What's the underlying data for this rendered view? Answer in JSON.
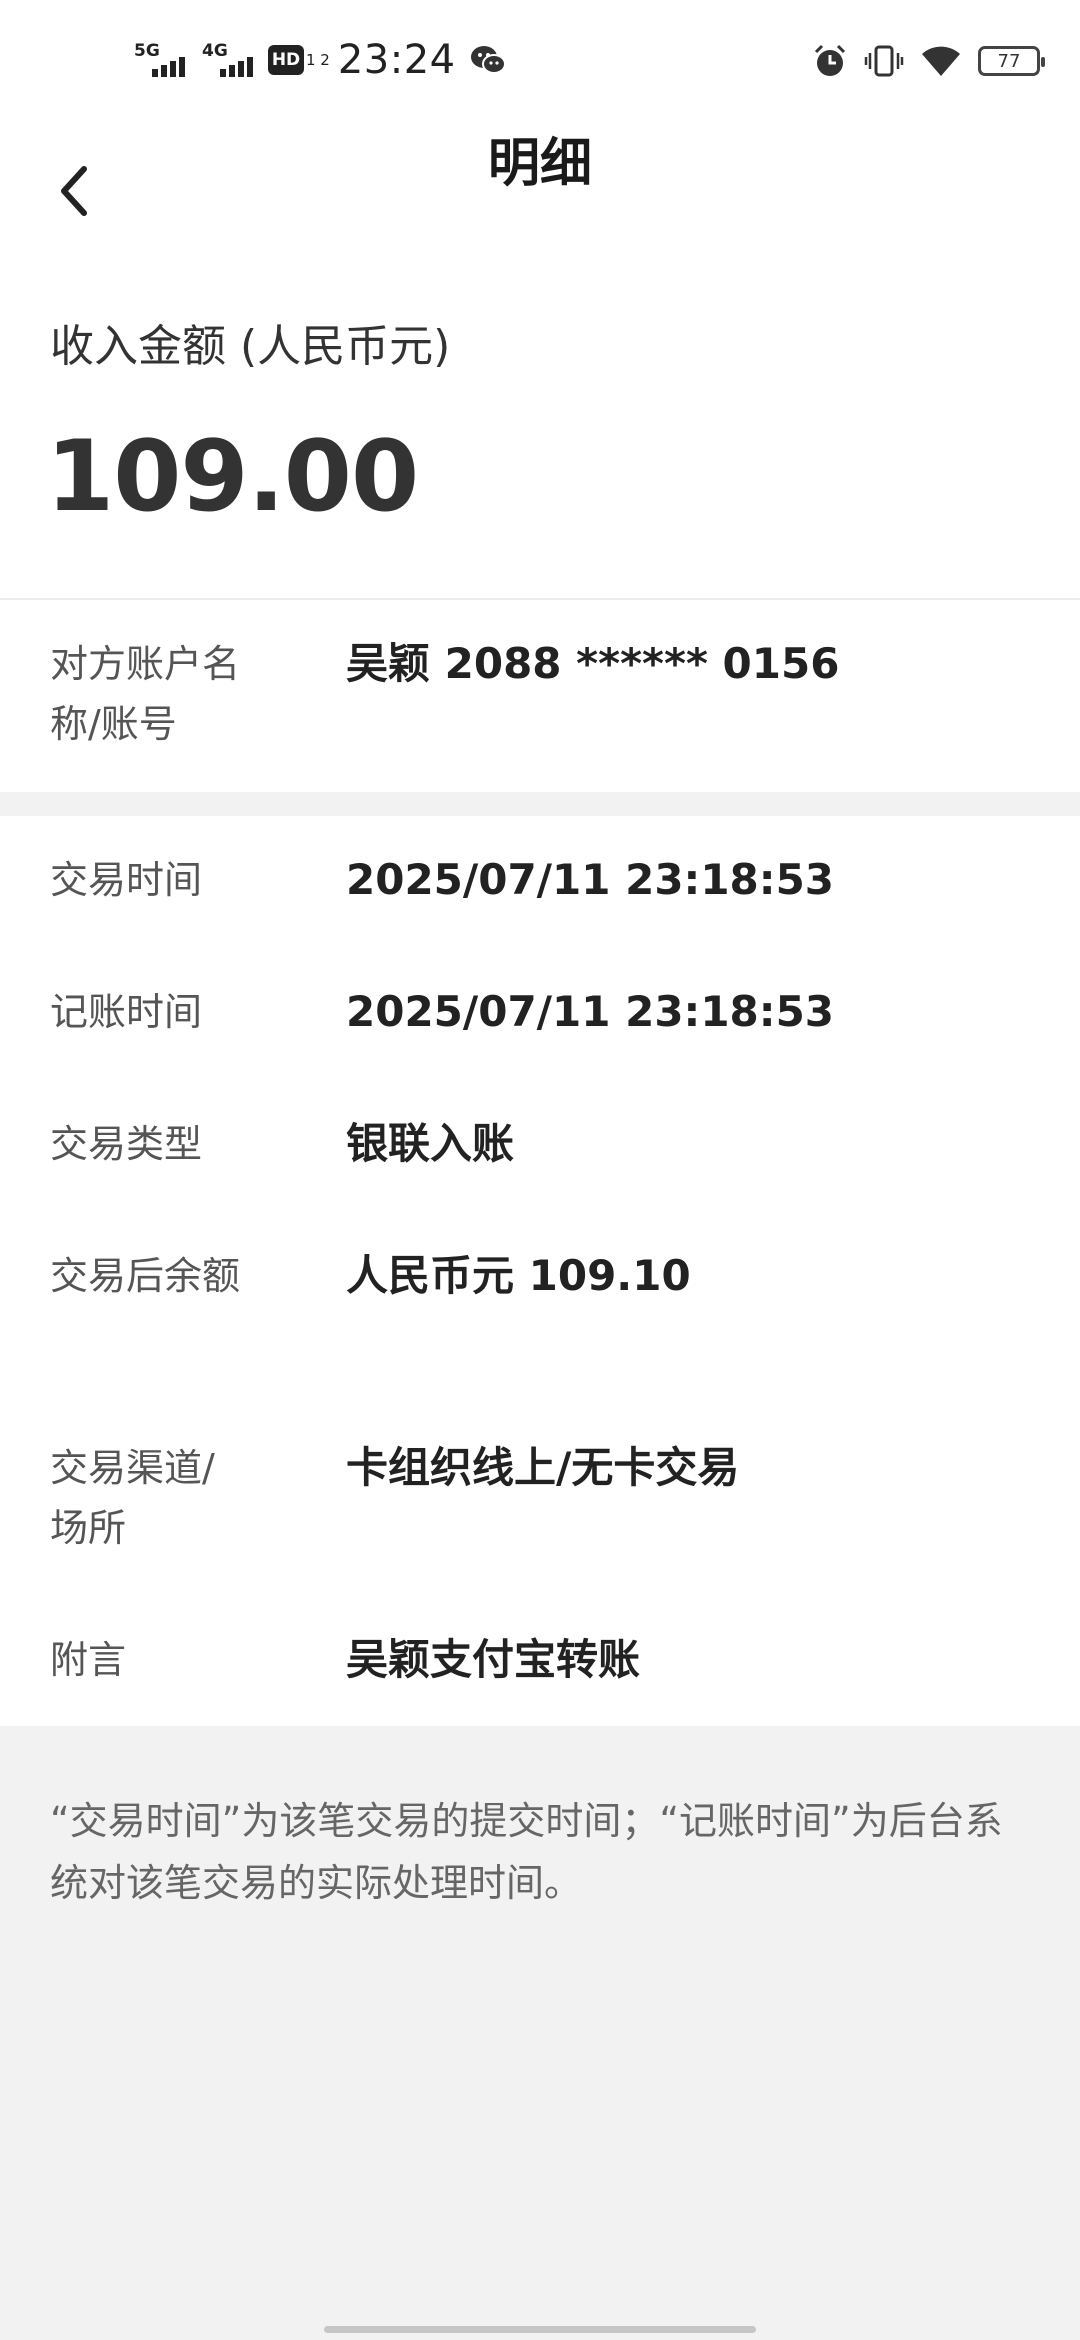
{
  "status_bar": {
    "network_1": "5G",
    "network_2": "4G",
    "hd_badge": "HD",
    "hd_sub": "1 2",
    "time": "23:24",
    "battery": "77"
  },
  "nav": {
    "title": "明细"
  },
  "amount": {
    "label": "收入金额 (人民币元)",
    "value": "109.00"
  },
  "account": {
    "label": "对方账户名称/账号",
    "value": "吴颖 2088 ****** 0156"
  },
  "details": [
    {
      "label": "交易时间",
      "value": "2025/07/11 23:18:53"
    },
    {
      "label": "记账时间",
      "value": "2025/07/11 23:18:53"
    },
    {
      "label": "交易类型",
      "value": "银联入账"
    },
    {
      "label": "交易后余额",
      "value": "人民币元 109.10"
    },
    {
      "label": "交易渠道/场所",
      "value": "卡组织线上/无卡交易"
    },
    {
      "label": "附言",
      "value": "吴颖支付宝转账"
    }
  ],
  "footnote": "“交易时间”为该笔交易的提交时间；“记账时间”为后台系统对该笔交易的实际处理时间。"
}
